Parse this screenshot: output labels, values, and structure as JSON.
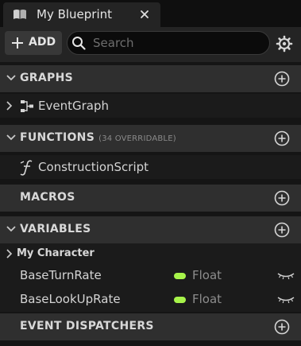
{
  "tab": {
    "title": "My Blueprint",
    "icon": "book-icon"
  },
  "toolbar": {
    "add_label": "ADD",
    "search_placeholder": "Search",
    "search_value": ""
  },
  "sections": {
    "graphs": {
      "title": "GRAPHS",
      "items": [
        {
          "label": "EventGraph",
          "icon": "event-graph-icon"
        }
      ]
    },
    "functions": {
      "title": "FUNCTIONS",
      "subtitle": "(34 OVERRIDABLE)",
      "items": [
        {
          "label": "ConstructionScript",
          "icon": "function-icon"
        }
      ]
    },
    "macros": {
      "title": "MACROS"
    },
    "variables": {
      "title": "VARIABLES",
      "category": "My Character",
      "items": [
        {
          "name": "BaseTurnRate",
          "type": "Float"
        },
        {
          "name": "BaseLookUpRate",
          "type": "Float"
        }
      ]
    },
    "event_dispatchers": {
      "title": "EVENT DISPATCHERS"
    }
  },
  "colors": {
    "panel": "#242424",
    "section_header": "#2f2f2f",
    "row_bg": "#1b1b1b",
    "float_type": "#a7f34a"
  }
}
